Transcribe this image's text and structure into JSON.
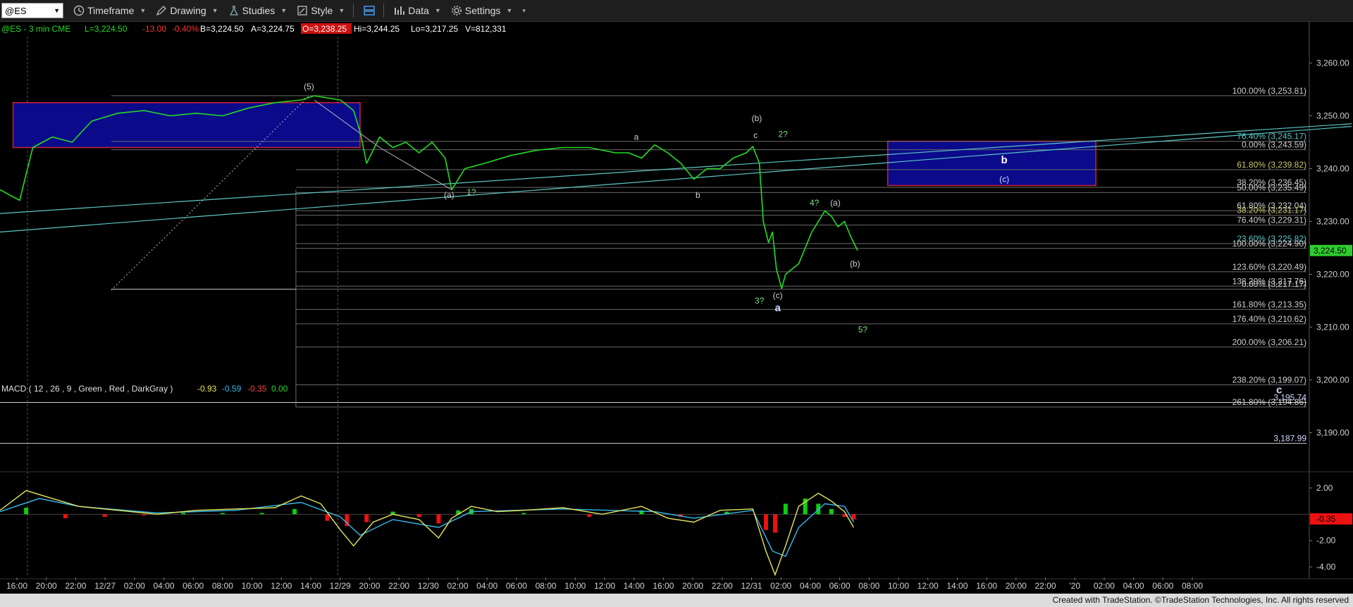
{
  "toolbar": {
    "symbol": "@ES",
    "timeframe": "Timeframe",
    "drawing": "Drawing",
    "studies": "Studies",
    "style": "Style",
    "data": "Data",
    "settings": "Settings"
  },
  "header": {
    "symbol_line": "@ES - 3 min  CME",
    "last": "L=3,224.50",
    "change": "-13.00",
    "pct": "-0.40%",
    "bid": "B=3,224.50",
    "ask": "A=3,224.75",
    "open": "O=3,238.25",
    "high": "Hi=3,244.25",
    "low": "Lo=3,217.25",
    "volume": "V=812,331"
  },
  "macd_header": {
    "label": "MACD ( 12 , 26 , 9 , Green , Red , DarkGray )",
    "v1": "-0.93",
    "v2": "-0.59",
    "v3": "-0.35",
    "v4": "0.00"
  },
  "colors": {
    "price": "#22dd22",
    "macd_line": "#e6e65a",
    "signal_line": "#33bbee",
    "hist_pos": "#11cc11",
    "hist_neg": "#ee1111",
    "box": "#0a0a8a",
    "box_border": "#cc2233",
    "trend": "#5cc7c7",
    "last_price_bg": "#2ecc2e"
  },
  "footer": "Created with TradeStation. ©TradeStation Technologies, Inc. All rights reserved",
  "chart_data": {
    "type": "line",
    "instrument": "@ES - 3 min",
    "yaxis": {
      "ticks": [
        "3,260.00",
        "3,250.00",
        "3,240.00",
        "3,230.00",
        "3,220.00",
        "3,210.00",
        "3,200.00",
        "3,190.00"
      ],
      "tick_values": [
        3260,
        3250,
        3240,
        3230,
        3220,
        3210,
        3200,
        3190
      ],
      "range": [
        3183,
        3265
      ]
    },
    "xaxis": {
      "ticks": [
        "16:00",
        "20:00",
        "22:00",
        "12/27",
        "02:00",
        "04:00",
        "06:00",
        "08:00",
        "10:00",
        "12:00",
        "14:00",
        "12/29",
        "20:00",
        "22:00",
        "12/30",
        "02:00",
        "04:00",
        "06:00",
        "08:00",
        "10:00",
        "12:00",
        "14:00",
        "16:00",
        "20:00",
        "22:00",
        "12/31",
        "02:00",
        "04:00",
        "06:00",
        "08:00",
        "10:00",
        "12:00",
        "14:00",
        "16:00",
        "20:00",
        "22:00",
        "'20",
        "02:00",
        "04:00",
        "06:00",
        "08:00"
      ]
    },
    "price_series": [
      [
        0,
        3236
      ],
      [
        0.015,
        3234
      ],
      [
        0.025,
        3244
      ],
      [
        0.04,
        3246
      ],
      [
        0.055,
        3245
      ],
      [
        0.07,
        3249
      ],
      [
        0.09,
        3250.5
      ],
      [
        0.11,
        3251
      ],
      [
        0.13,
        3250
      ],
      [
        0.15,
        3250.5
      ],
      [
        0.17,
        3250
      ],
      [
        0.19,
        3251.5
      ],
      [
        0.21,
        3252.5
      ],
      [
        0.23,
        3253
      ],
      [
        0.24,
        3253.8
      ],
      [
        0.26,
        3253
      ],
      [
        0.27,
        3251
      ],
      [
        0.275,
        3247
      ],
      [
        0.28,
        3241
      ],
      [
        0.29,
        3246
      ],
      [
        0.3,
        3244
      ],
      [
        0.31,
        3245
      ],
      [
        0.32,
        3243
      ],
      [
        0.33,
        3245
      ],
      [
        0.34,
        3242
      ],
      [
        0.345,
        3236
      ],
      [
        0.355,
        3240
      ],
      [
        0.37,
        3241
      ],
      [
        0.39,
        3242.5
      ],
      [
        0.41,
        3243.5
      ],
      [
        0.43,
        3244
      ],
      [
        0.45,
        3244
      ],
      [
        0.47,
        3243
      ],
      [
        0.48,
        3243
      ],
      [
        0.49,
        3242
      ],
      [
        0.5,
        3244.5
      ],
      [
        0.51,
        3243
      ],
      [
        0.52,
        3241
      ],
      [
        0.53,
        3238
      ],
      [
        0.54,
        3240
      ],
      [
        0.55,
        3240
      ],
      [
        0.56,
        3242
      ],
      [
        0.57,
        3243
      ],
      [
        0.575,
        3244.2
      ],
      [
        0.58,
        3241
      ],
      [
        0.583,
        3230
      ],
      [
        0.587,
        3226
      ],
      [
        0.59,
        3228
      ],
      [
        0.593,
        3221
      ],
      [
        0.597,
        3217.3
      ],
      [
        0.6,
        3220
      ],
      [
        0.61,
        3222
      ],
      [
        0.62,
        3228
      ],
      [
        0.625,
        3230
      ],
      [
        0.63,
        3232
      ],
      [
        0.635,
        3231
      ],
      [
        0.64,
        3229
      ],
      [
        0.645,
        3230
      ],
      [
        0.65,
        3227
      ],
      [
        0.655,
        3224.5
      ]
    ],
    "current_price": "3,224.50",
    "fib_labels": [
      {
        "text": "100.00% (3,253.81)",
        "value": 3253.81
      },
      {
        "text": "76.40% (3,245.17)",
        "value": 3245.17
      },
      {
        "text": "0.00% (3,243.59)",
        "value": 3243.59
      },
      {
        "text": "61.80% (3,239.82)",
        "value": 3239.82
      },
      {
        "text": "38.20% (3,236.45)",
        "value": 3236.45
      },
      {
        "text": "50.00% (3,235.49)",
        "value": 3235.49
      },
      {
        "text": "61.80% (3,232.04)",
        "value": 3232.04
      },
      {
        "text": "38.20% (3,231.17)",
        "value": 3231.17
      },
      {
        "text": "76.40% (3,229.31)",
        "value": 3229.31
      },
      {
        "text": "23.60% (3,225.82)",
        "value": 3225.82
      },
      {
        "text": "100.00% (3,224.90)",
        "value": 3224.9
      },
      {
        "text": "123.60% (3,220.49)",
        "value": 3220.49
      },
      {
        "text": "138.20% (3,217.76)",
        "value": 3217.76
      },
      {
        "text": "0.00% (3,217.17)",
        "value": 3217.17
      },
      {
        "text": "161.80% (3,213.35)",
        "value": 3213.35
      },
      {
        "text": "176.40% (3,210.62)",
        "value": 3210.62
      },
      {
        "text": "200.00% (3,206.21)",
        "value": 3206.21
      },
      {
        "text": "238.20% (3,199.07)",
        "value": 3199.07
      },
      {
        "text": "261.80% (3,194.86)",
        "value": 3194.86
      }
    ],
    "level_labels": [
      {
        "text": "3,195.74",
        "value": 3195.74
      },
      {
        "text": "3,187.99",
        "value": 3187.99
      }
    ],
    "wave_labels": [
      {
        "text": "(5)",
        "t": 0.236,
        "value": 3255,
        "color": "#cfcfcf"
      },
      {
        "text": "(a)",
        "t": 0.343,
        "value": 3234.5,
        "color": "#cfcfcf"
      },
      {
        "text": "1?",
        "t": 0.36,
        "value": 3235,
        "color": "#7fe07f"
      },
      {
        "text": "a",
        "t": 0.486,
        "value": 3245.5,
        "color": "#cfcfcf"
      },
      {
        "text": "b",
        "t": 0.533,
        "value": 3234.5,
        "color": "#cfcfcf"
      },
      {
        "text": "(b)",
        "t": 0.578,
        "value": 3249,
        "color": "#cfcfcf"
      },
      {
        "text": "c",
        "t": 0.577,
        "value": 3245.8,
        "color": "#cfcfcf"
      },
      {
        "text": "2?",
        "t": 0.598,
        "value": 3246,
        "color": "#7fe07f"
      },
      {
        "text": "4?",
        "t": 0.622,
        "value": 3233,
        "color": "#7fe07f"
      },
      {
        "text": "(a)",
        "t": 0.638,
        "value": 3233,
        "color": "#cfcfcf"
      },
      {
        "text": "(b)",
        "t": 0.653,
        "value": 3221.5,
        "color": "#cfcfcf"
      },
      {
        "text": "(c)",
        "t": 0.594,
        "value": 3215.5,
        "color": "#cfcfcf"
      },
      {
        "text": "3?",
        "t": 0.58,
        "value": 3214.5,
        "color": "#7fe07f"
      },
      {
        "text": "a",
        "t": 0.594,
        "value": 3213,
        "color": "#cfd8ff",
        "bold": true
      },
      {
        "text": "5?",
        "t": 0.659,
        "value": 3209,
        "color": "#7fe07f"
      },
      {
        "text": "b",
        "t": 0.767,
        "value": 3241,
        "color": "#ffffff",
        "bold": true
      },
      {
        "text": "(c)",
        "t": 0.767,
        "value": 3237.5,
        "color": "#cfd8ff"
      },
      {
        "text": "c",
        "t": 0.977,
        "value": 3197.5,
        "color": "#cfd8ff",
        "bold": true
      }
    ],
    "target_boxes": [
      {
        "t0": 0.01,
        "t1": 0.275,
        "top": 3252.5,
        "bottom": 3244
      },
      {
        "t0": 0.678,
        "t1": 0.837,
        "top": 3245.2,
        "bottom": 3236.8
      }
    ],
    "macd": {
      "yticks": [
        "2.00",
        "-2.00",
        "-4.00"
      ],
      "ytick_values": [
        2,
        -2,
        -4
      ],
      "range": [
        -4.8,
        2.8
      ],
      "current": "-0.35",
      "macd_line": [
        [
          0,
          0.3
        ],
        [
          0.02,
          1.8
        ],
        [
          0.04,
          1.2
        ],
        [
          0.06,
          0.6
        ],
        [
          0.09,
          0.3
        ],
        [
          0.12,
          0
        ],
        [
          0.15,
          0.3
        ],
        [
          0.18,
          0.4
        ],
        [
          0.21,
          0.5
        ],
        [
          0.23,
          1.4
        ],
        [
          0.245,
          0.8
        ],
        [
          0.26,
          -1.2
        ],
        [
          0.27,
          -2.4
        ],
        [
          0.285,
          -0.6
        ],
        [
          0.3,
          0
        ],
        [
          0.32,
          -0.4
        ],
        [
          0.335,
          -1.8
        ],
        [
          0.345,
          -0.3
        ],
        [
          0.36,
          0.6
        ],
        [
          0.38,
          0.2
        ],
        [
          0.4,
          0.3
        ],
        [
          0.43,
          0.5
        ],
        [
          0.46,
          0
        ],
        [
          0.49,
          0.6
        ],
        [
          0.51,
          -0.3
        ],
        [
          0.53,
          -0.6
        ],
        [
          0.55,
          0.3
        ],
        [
          0.575,
          0.4
        ],
        [
          0.585,
          -2.8
        ],
        [
          0.592,
          -4.6
        ],
        [
          0.6,
          -2.4
        ],
        [
          0.61,
          0.6
        ],
        [
          0.625,
          1.6
        ],
        [
          0.635,
          1.0
        ],
        [
          0.645,
          0.2
        ],
        [
          0.652,
          -1.0
        ]
      ],
      "signal_line": [
        [
          0,
          0.2
        ],
        [
          0.03,
          1.2
        ],
        [
          0.06,
          0.6
        ],
        [
          0.12,
          0.1
        ],
        [
          0.18,
          0.3
        ],
        [
          0.23,
          0.9
        ],
        [
          0.26,
          -0.2
        ],
        [
          0.275,
          -1.6
        ],
        [
          0.3,
          -0.4
        ],
        [
          0.335,
          -1.0
        ],
        [
          0.36,
          0.2
        ],
        [
          0.43,
          0.4
        ],
        [
          0.5,
          0.2
        ],
        [
          0.53,
          -0.3
        ],
        [
          0.575,
          0.3
        ],
        [
          0.59,
          -2.8
        ],
        [
          0.6,
          -3.2
        ],
        [
          0.61,
          -1.0
        ],
        [
          0.63,
          0.8
        ],
        [
          0.645,
          0.6
        ],
        [
          0.652,
          -0.6
        ]
      ],
      "histogram": [
        [
          0.02,
          0.5
        ],
        [
          0.05,
          -0.3
        ],
        [
          0.08,
          -0.2
        ],
        [
          0.11,
          -0.1
        ],
        [
          0.14,
          0.1
        ],
        [
          0.17,
          0.1
        ],
        [
          0.2,
          0.1
        ],
        [
          0.225,
          0.4
        ],
        [
          0.25,
          -0.5
        ],
        [
          0.265,
          -0.9
        ],
        [
          0.28,
          -0.6
        ],
        [
          0.3,
          0.2
        ],
        [
          0.32,
          -0.2
        ],
        [
          0.335,
          -0.7
        ],
        [
          0.35,
          0.3
        ],
        [
          0.36,
          0.4
        ],
        [
          0.4,
          0.1
        ],
        [
          0.45,
          -0.2
        ],
        [
          0.49,
          0.3
        ],
        [
          0.52,
          -0.2
        ],
        [
          0.555,
          0.2
        ],
        [
          0.585,
          -1.2
        ],
        [
          0.592,
          -1.4
        ],
        [
          0.6,
          0.8
        ],
        [
          0.615,
          1.2
        ],
        [
          0.625,
          0.8
        ],
        [
          0.635,
          0.4
        ],
        [
          0.645,
          -0.2
        ],
        [
          0.652,
          -0.4
        ]
      ]
    }
  }
}
